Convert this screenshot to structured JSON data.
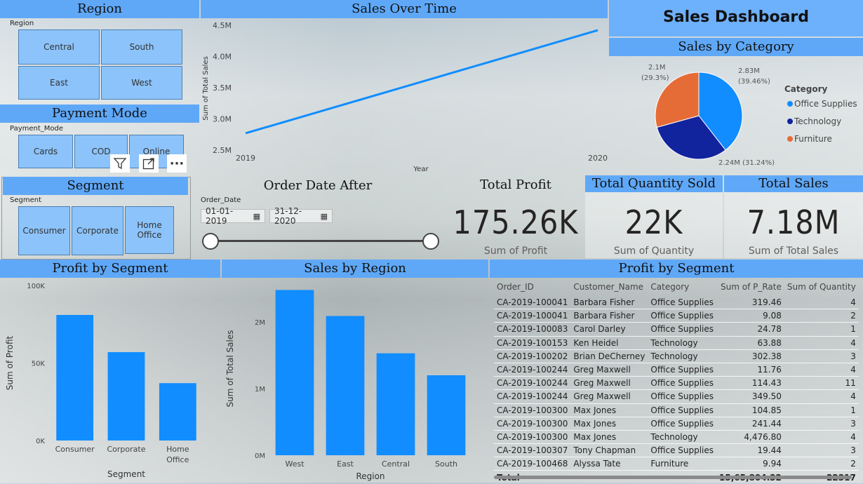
{
  "dashboard_title": "Sales Dashboard",
  "region_panel": {
    "header": "Region",
    "field_label": "Region",
    "options": [
      "Central",
      "South",
      "East",
      "West"
    ]
  },
  "payment_panel": {
    "header": "Payment Mode",
    "field_label": "Payment_Mode",
    "options": [
      "Cards",
      "COD",
      "Online"
    ]
  },
  "segment_panel": {
    "header": "Segment",
    "field_label": "Segment",
    "options": [
      "Consumer",
      "Corporate",
      "Home Office"
    ]
  },
  "visual_toolbar": {
    "filter_icon": "filter-icon",
    "focus_icon": "focus-mode-icon",
    "more_icon": "more-options-icon",
    "more_glyph": "···"
  },
  "sales_over_time": {
    "header": "Sales Over Time",
    "chart_data": {
      "type": "line",
      "x": [
        "2019",
        "2020"
      ],
      "series": [
        {
          "values": [
            2.77,
            4.42
          ]
        }
      ],
      "xlabel": "Year",
      "ylabel": "Sum of Total Sales",
      "yticks": [
        "2.5M",
        "3.0M",
        "3.5M",
        "4.0M",
        "4.5M"
      ],
      "ylim": [
        2.5,
        4.5
      ],
      "color": "#118dff"
    }
  },
  "sales_by_category": {
    "header": "Sales by Category",
    "chart_data": {
      "type": "pie",
      "legend_title": "Category",
      "legend_position": "right",
      "slices": [
        {
          "name": "Office Supplies",
          "value": 2.83,
          "label": "2.83M",
          "pct": "(39.46%)",
          "color": "#118dff"
        },
        {
          "name": "Technology",
          "value": 2.24,
          "label": "2.24M (31.24%)",
          "pct": "",
          "color": "#12239e"
        },
        {
          "name": "Furniture",
          "value": 2.1,
          "label": "2.1M",
          "pct": "(29.3%)",
          "color": "#e66c37"
        }
      ]
    }
  },
  "order_date": {
    "header": "Order Date After",
    "field_label": "Order_Date",
    "start": "01-01-2019",
    "end": "31-12-2020"
  },
  "kpis": [
    {
      "header": "Total Profit",
      "value": "175.26K",
      "label": "Sum of Profit"
    },
    {
      "header": "Total Quantity Sold",
      "value": "22K",
      "label": "Sum of Quantity"
    },
    {
      "header": "Total Sales",
      "value": "7.18M",
      "label": "Sum of Total Sales"
    }
  ],
  "profit_by_segment": {
    "header": "Profit by Segment",
    "chart_data": {
      "type": "bar",
      "categories": [
        "Consumer",
        "Corporate",
        "Home Office"
      ],
      "values": [
        81000,
        57000,
        37000
      ],
      "xlabel": "Segment",
      "ylabel": "Sum of Profit",
      "yticks": [
        "0K",
        "50K",
        "100K"
      ],
      "ylim": [
        0,
        100000
      ],
      "color": "#118dff"
    }
  },
  "sales_by_region": {
    "header": "Sales by Region",
    "chart_data": {
      "type": "bar",
      "categories": [
        "West",
        "East",
        "Central",
        "South"
      ],
      "values": [
        2.48,
        2.09,
        1.53,
        1.2
      ],
      "xlabel": "Region",
      "ylabel": "Sum of Total Sales",
      "yticks": [
        "0M",
        "1M",
        "2M"
      ],
      "ylim": [
        0,
        2.6
      ],
      "color": "#118dff"
    }
  },
  "profit_table": {
    "header": "Profit by Segment",
    "columns": [
      "Order_ID",
      "Customer_Name",
      "Category",
      "Sum of P_Rate",
      "Sum of Quantity"
    ],
    "rows": [
      [
        "CA-2019-100041",
        "Barbara Fisher",
        "Office Supplies",
        "319.46",
        "4"
      ],
      [
        "CA-2019-100041",
        "Barbara Fisher",
        "Office Supplies",
        "9.08",
        "2"
      ],
      [
        "CA-2019-100083",
        "Carol Darley",
        "Office Supplies",
        "24.78",
        "1"
      ],
      [
        "CA-2019-100153",
        "Ken Heidel",
        "Technology",
        "63.88",
        "4"
      ],
      [
        "CA-2019-100202",
        "Brian DeCherney",
        "Technology",
        "302.38",
        "3"
      ],
      [
        "CA-2019-100244",
        "Greg Maxwell",
        "Office Supplies",
        "11.76",
        "4"
      ],
      [
        "CA-2019-100244",
        "Greg Maxwell",
        "Office Supplies",
        "114.43",
        "11"
      ],
      [
        "CA-2019-100244",
        "Greg Maxwell",
        "Office Supplies",
        "349.50",
        "4"
      ],
      [
        "CA-2019-100300",
        "Max Jones",
        "Office Supplies",
        "104.85",
        "1"
      ],
      [
        "CA-2019-100300",
        "Max Jones",
        "Office Supplies",
        "241.44",
        "3"
      ],
      [
        "CA-2019-100300",
        "Max Jones",
        "Technology",
        "4,476.80",
        "4"
      ],
      [
        "CA-2019-100307",
        "Tony Chapman",
        "Office Supplies",
        "19.44",
        "3"
      ],
      [
        "CA-2019-100468",
        "Alyssa Tate",
        "Furniture",
        "9.94",
        "2"
      ]
    ],
    "total": {
      "label": "Total",
      "p_rate": "15,65,804.32",
      "quantity": "22317"
    }
  }
}
